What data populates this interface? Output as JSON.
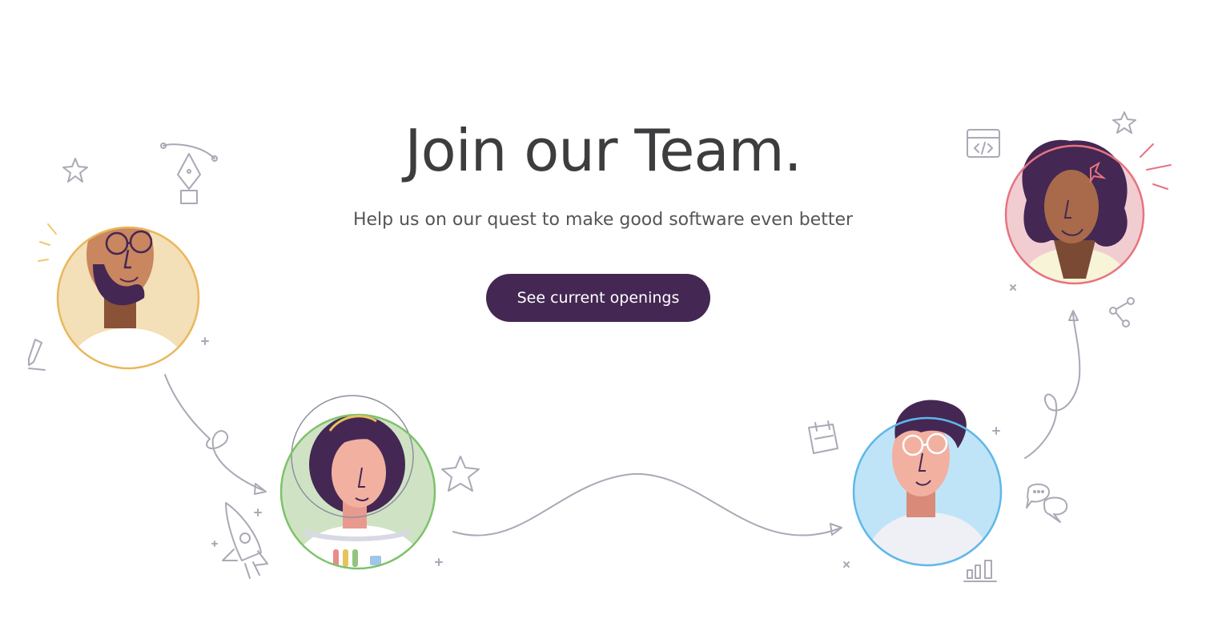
{
  "hero": {
    "title": "Join our Team.",
    "subtitle": "Help us on our quest to make good software even better",
    "cta_label": "See current openings"
  },
  "colors": {
    "title": "#3d3d3f",
    "subtitle": "#555558",
    "cta_background": "#442753",
    "cta_text": "#ffffff",
    "doodle_stroke": "#a9a9b6",
    "avatar_1_bg": "#f3dfb8",
    "avatar_2_bg": "#cfe3c4",
    "avatar_3_bg": "#bfe4f7",
    "avatar_4_bg": "#f1cdd2"
  },
  "icons": [
    "star-icon",
    "pen-tool-icon",
    "pencil-icon",
    "rocket-icon",
    "calendar-icon",
    "code-window-icon",
    "share-network-icon",
    "chat-bubbles-icon",
    "bar-chart-icon",
    "arrow-icon"
  ]
}
